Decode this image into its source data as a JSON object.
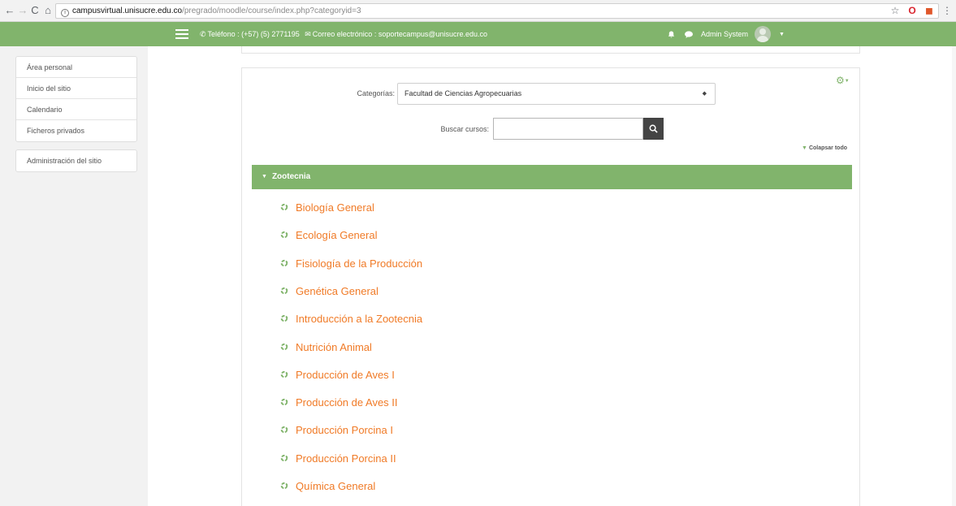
{
  "browser": {
    "back": "←",
    "forward": "→",
    "reload": "C",
    "home": "⌂",
    "url_host": "campusvirtual.unisucre.edu.co",
    "url_path": "/pregrado/moodle/course/index.php?categoryid=3",
    "star": "☆",
    "ext_opera": "O",
    "ext_office": "◼",
    "menu": "⋮"
  },
  "navbar": {
    "phone_text": "Teléfono : (+57) (5) 2771195",
    "email_text": "Correo electrónico : soportecampus@unisucre.edu.co",
    "user_name": "Admin System",
    "accent_color": "#81b46c"
  },
  "sidebar": {
    "items": [
      "Área personal",
      "Inicio del sitio",
      "Calendario",
      "Ficheros privados"
    ],
    "admin_item": "Administración del sitio"
  },
  "main": {
    "category_label": "Categorías:",
    "category_selected": "Facultad de Ciencias Agropecuarias",
    "search_label": "Buscar cursos:",
    "search_value": "",
    "collapse_all": "Colapsar todo",
    "category_name": "Zootecnia",
    "courses": [
      "Biología General",
      "Ecología General",
      "Fisiología de la Producción",
      "Genética General",
      "Introducción a la Zootecnia",
      "Nutrición Animal",
      "Producción de Aves I",
      "Producción de Aves II",
      "Producción Porcina I",
      "Producción Porcina II",
      "Química General"
    ],
    "link_color": "#f07a26"
  }
}
